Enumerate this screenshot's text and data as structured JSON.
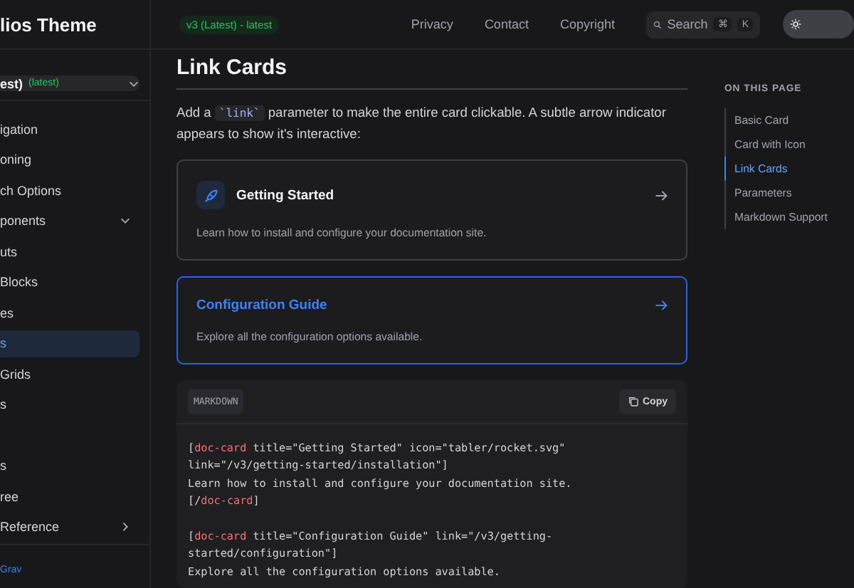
{
  "site_title": "lios Theme",
  "version_badge": "v3 (Latest) - latest",
  "nav_links": [
    "Privacy",
    "Contact",
    "Copyright"
  ],
  "search": {
    "placeholder": "Search",
    "keys": [
      "⌘",
      "K"
    ]
  },
  "theme_toggle": {
    "light": true
  },
  "version_select": {
    "value": "est)",
    "tag": "(latest)"
  },
  "sidebar": {
    "items": [
      {
        "label": "igation",
        "selected": false
      },
      {
        "label": "oning",
        "selected": false
      },
      {
        "label": "ch Options",
        "selected": false
      },
      {
        "label": "ponents",
        "selected": false,
        "expanded": true
      },
      {
        "label": "uts",
        "selected": false
      },
      {
        "label": "Blocks",
        "selected": false
      },
      {
        "label": "es",
        "selected": false
      },
      {
        "label": "s",
        "selected": true
      },
      {
        "label": "Grids",
        "selected": false
      },
      {
        "label": "s",
        "selected": false
      },
      {
        "label": "s",
        "selected": false
      },
      {
        "label": "ree",
        "selected": false
      },
      {
        "label": "Reference",
        "selected": false,
        "expanded": false
      }
    ],
    "footer_link": "Grav"
  },
  "page_title": "Link Cards",
  "intro": {
    "before": "Add a ",
    "code": "`link`",
    "after": " parameter to make the entire card clickable. A subtle arrow indicator appears to show it's interactive:"
  },
  "cards": [
    {
      "title": "Getting Started",
      "description": "Learn how to install and configure your documentation site.",
      "has_icon": true,
      "selected": false
    },
    {
      "title": "Configuration Guide",
      "description": "Explore all the configuration options available.",
      "has_icon": false,
      "selected": true
    }
  ],
  "code_block": {
    "language": "MARKDOWN",
    "copy_label": "Copy",
    "lines": [
      {
        "space_before": false,
        "segments": [
          {
            "kind": "punct",
            "text": "["
          },
          {
            "kind": "tag",
            "text": "doc-card"
          },
          {
            "kind": "text",
            "text": " title=\"Getting Started\" icon=\"tabler/rocket.svg\""
          }
        ]
      },
      {
        "space_before": false,
        "segments": [
          {
            "kind": "text",
            "text": "link=\"/v3/getting-started/installation\"]"
          }
        ]
      },
      {
        "space_before": false,
        "segments": [
          {
            "kind": "text",
            "text": "Learn how to install and configure your documentation site."
          }
        ]
      },
      {
        "space_before": false,
        "segments": [
          {
            "kind": "punct",
            "text": "[/"
          },
          {
            "kind": "tag",
            "text": "doc-card"
          },
          {
            "kind": "punct",
            "text": "]"
          }
        ]
      },
      {
        "space_before": true,
        "segments": [
          {
            "kind": "punct",
            "text": "["
          },
          {
            "kind": "tag",
            "text": "doc-card"
          },
          {
            "kind": "text",
            "text": " title=\"Configuration Guide\" link=\"/v3/getting-"
          }
        ]
      },
      {
        "space_before": false,
        "segments": [
          {
            "kind": "text",
            "text": "started/configuration\"]"
          }
        ]
      },
      {
        "space_before": false,
        "segments": [
          {
            "kind": "text",
            "text": "Explore all the configuration options available."
          }
        ]
      }
    ]
  },
  "toc": {
    "heading": "ON THIS PAGE",
    "items": [
      {
        "label": "Basic Card",
        "selected": false
      },
      {
        "label": "Card with Icon",
        "selected": false
      },
      {
        "label": "Link Cards",
        "selected": true
      },
      {
        "label": "Parameters",
        "selected": false
      },
      {
        "label": "Markdown Support",
        "selected": false
      }
    ]
  }
}
